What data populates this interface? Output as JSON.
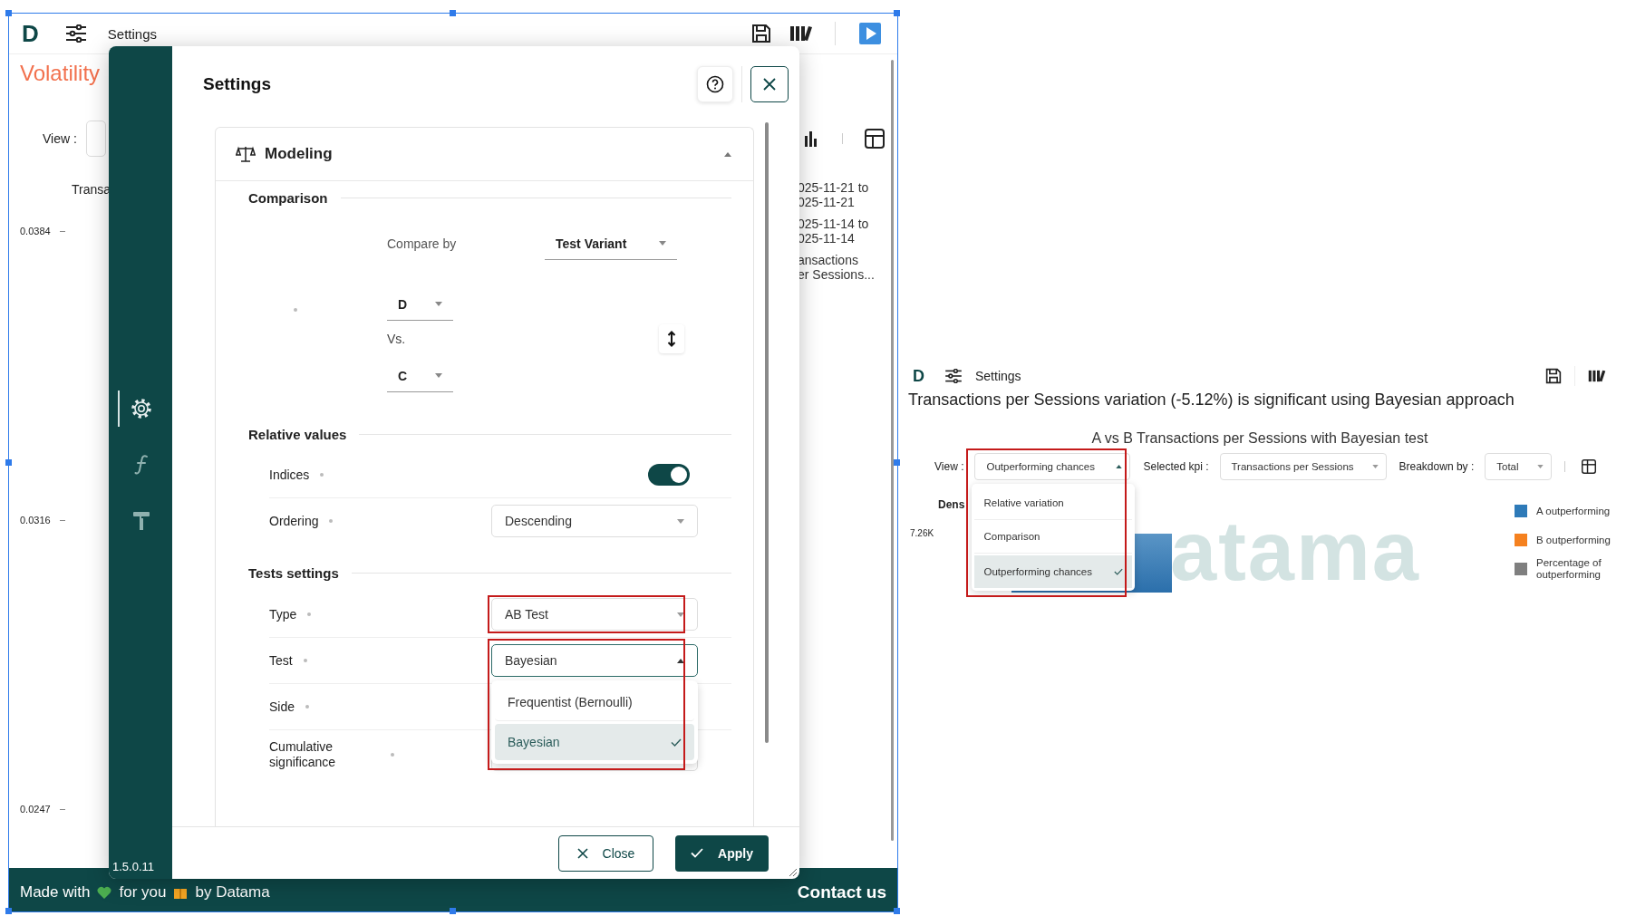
{
  "background_app": {
    "topbar": {
      "logo": "D",
      "title": "Settings"
    },
    "page_title": "Volatility",
    "view_label": "View :",
    "chart_label": "Transa",
    "y_ticks": [
      "0.0384",
      "0.0316",
      "0.0247"
    ],
    "side_notes": [
      [
        "025-11-21 to",
        "025-11-21"
      ],
      [
        "025-11-14 to",
        "025-11-14"
      ],
      [
        "ansactions",
        "er Sessions..."
      ]
    ],
    "footer": {
      "made_with": "Made with",
      "for_you": "for you",
      "by": "by Datama",
      "contact": "Contact us"
    }
  },
  "settings_modal": {
    "title": "Settings",
    "sidebar": [
      {
        "selected": true
      },
      {
        "selected": false
      },
      {
        "selected": false
      }
    ],
    "version": "1.5.0.11",
    "panel": {
      "title": "Modeling",
      "expanded": true,
      "comparison": {
        "heading": "Comparison",
        "compare_by_label": "Compare by",
        "compare_by_value": "Test Variant",
        "first_variant": "D",
        "vs_label": "Vs.",
        "second_variant": "C"
      },
      "groups": [
        {
          "heading": "Relative values",
          "rows": [
            {
              "kind": "toggle",
              "label": "Indices",
              "on": true
            },
            {
              "kind": "select",
              "label": "Ordering",
              "value": "Descending",
              "open": false
            }
          ]
        },
        {
          "heading": "Tests settings",
          "rows": [
            {
              "kind": "select",
              "label": "Type",
              "value": "AB Test",
              "open": false,
              "highlighted": true
            },
            {
              "kind": "select",
              "label": "Test",
              "value": "Bayesian",
              "open": true,
              "highlighted": true,
              "options": [
                {
                  "label": "Frequentist (Bernoulli)",
                  "selected": false
                },
                {
                  "label": "Bayesian",
                  "selected": true
                }
              ]
            },
            {
              "kind": "select",
              "label": "Side"
            },
            {
              "kind": "select",
              "label": "Cumulative significance"
            }
          ]
        }
      ]
    },
    "buttons": [
      {
        "kind": "secondary",
        "label": "Close"
      },
      {
        "kind": "primary",
        "label": "Apply"
      }
    ]
  },
  "result_app": {
    "topbar": {
      "logo": "D",
      "title": "Settings"
    },
    "headline": "Transactions per Sessions variation (-5.12%) is significant using Bayesian approach",
    "chart_title": "A vs B Transactions per Sessions with Bayesian test",
    "controls": [
      {
        "label": "View :",
        "value": "Outperforming chances",
        "open": true,
        "highlighted": true,
        "options": [
          {
            "label": "Relative variation",
            "selected": false
          },
          {
            "label": "Comparison",
            "selected": false
          },
          {
            "label": "Outperforming chances",
            "selected": true
          }
        ]
      },
      {
        "label": "Selected kpi :",
        "value": "Transactions per Sessions",
        "open": false
      },
      {
        "label": "Breakdown by :",
        "value": "Total",
        "open": false
      }
    ],
    "axis_label": "Dens",
    "y_tick": "7.26K",
    "watermark": "atama",
    "legend": [
      {
        "label": "A outperforming",
        "color": "#2e7ab8"
      },
      {
        "label": "B outperforming",
        "color": "#f5811f"
      },
      {
        "label": "Percentage of outperforming",
        "color": "#7f7f7f"
      }
    ]
  }
}
